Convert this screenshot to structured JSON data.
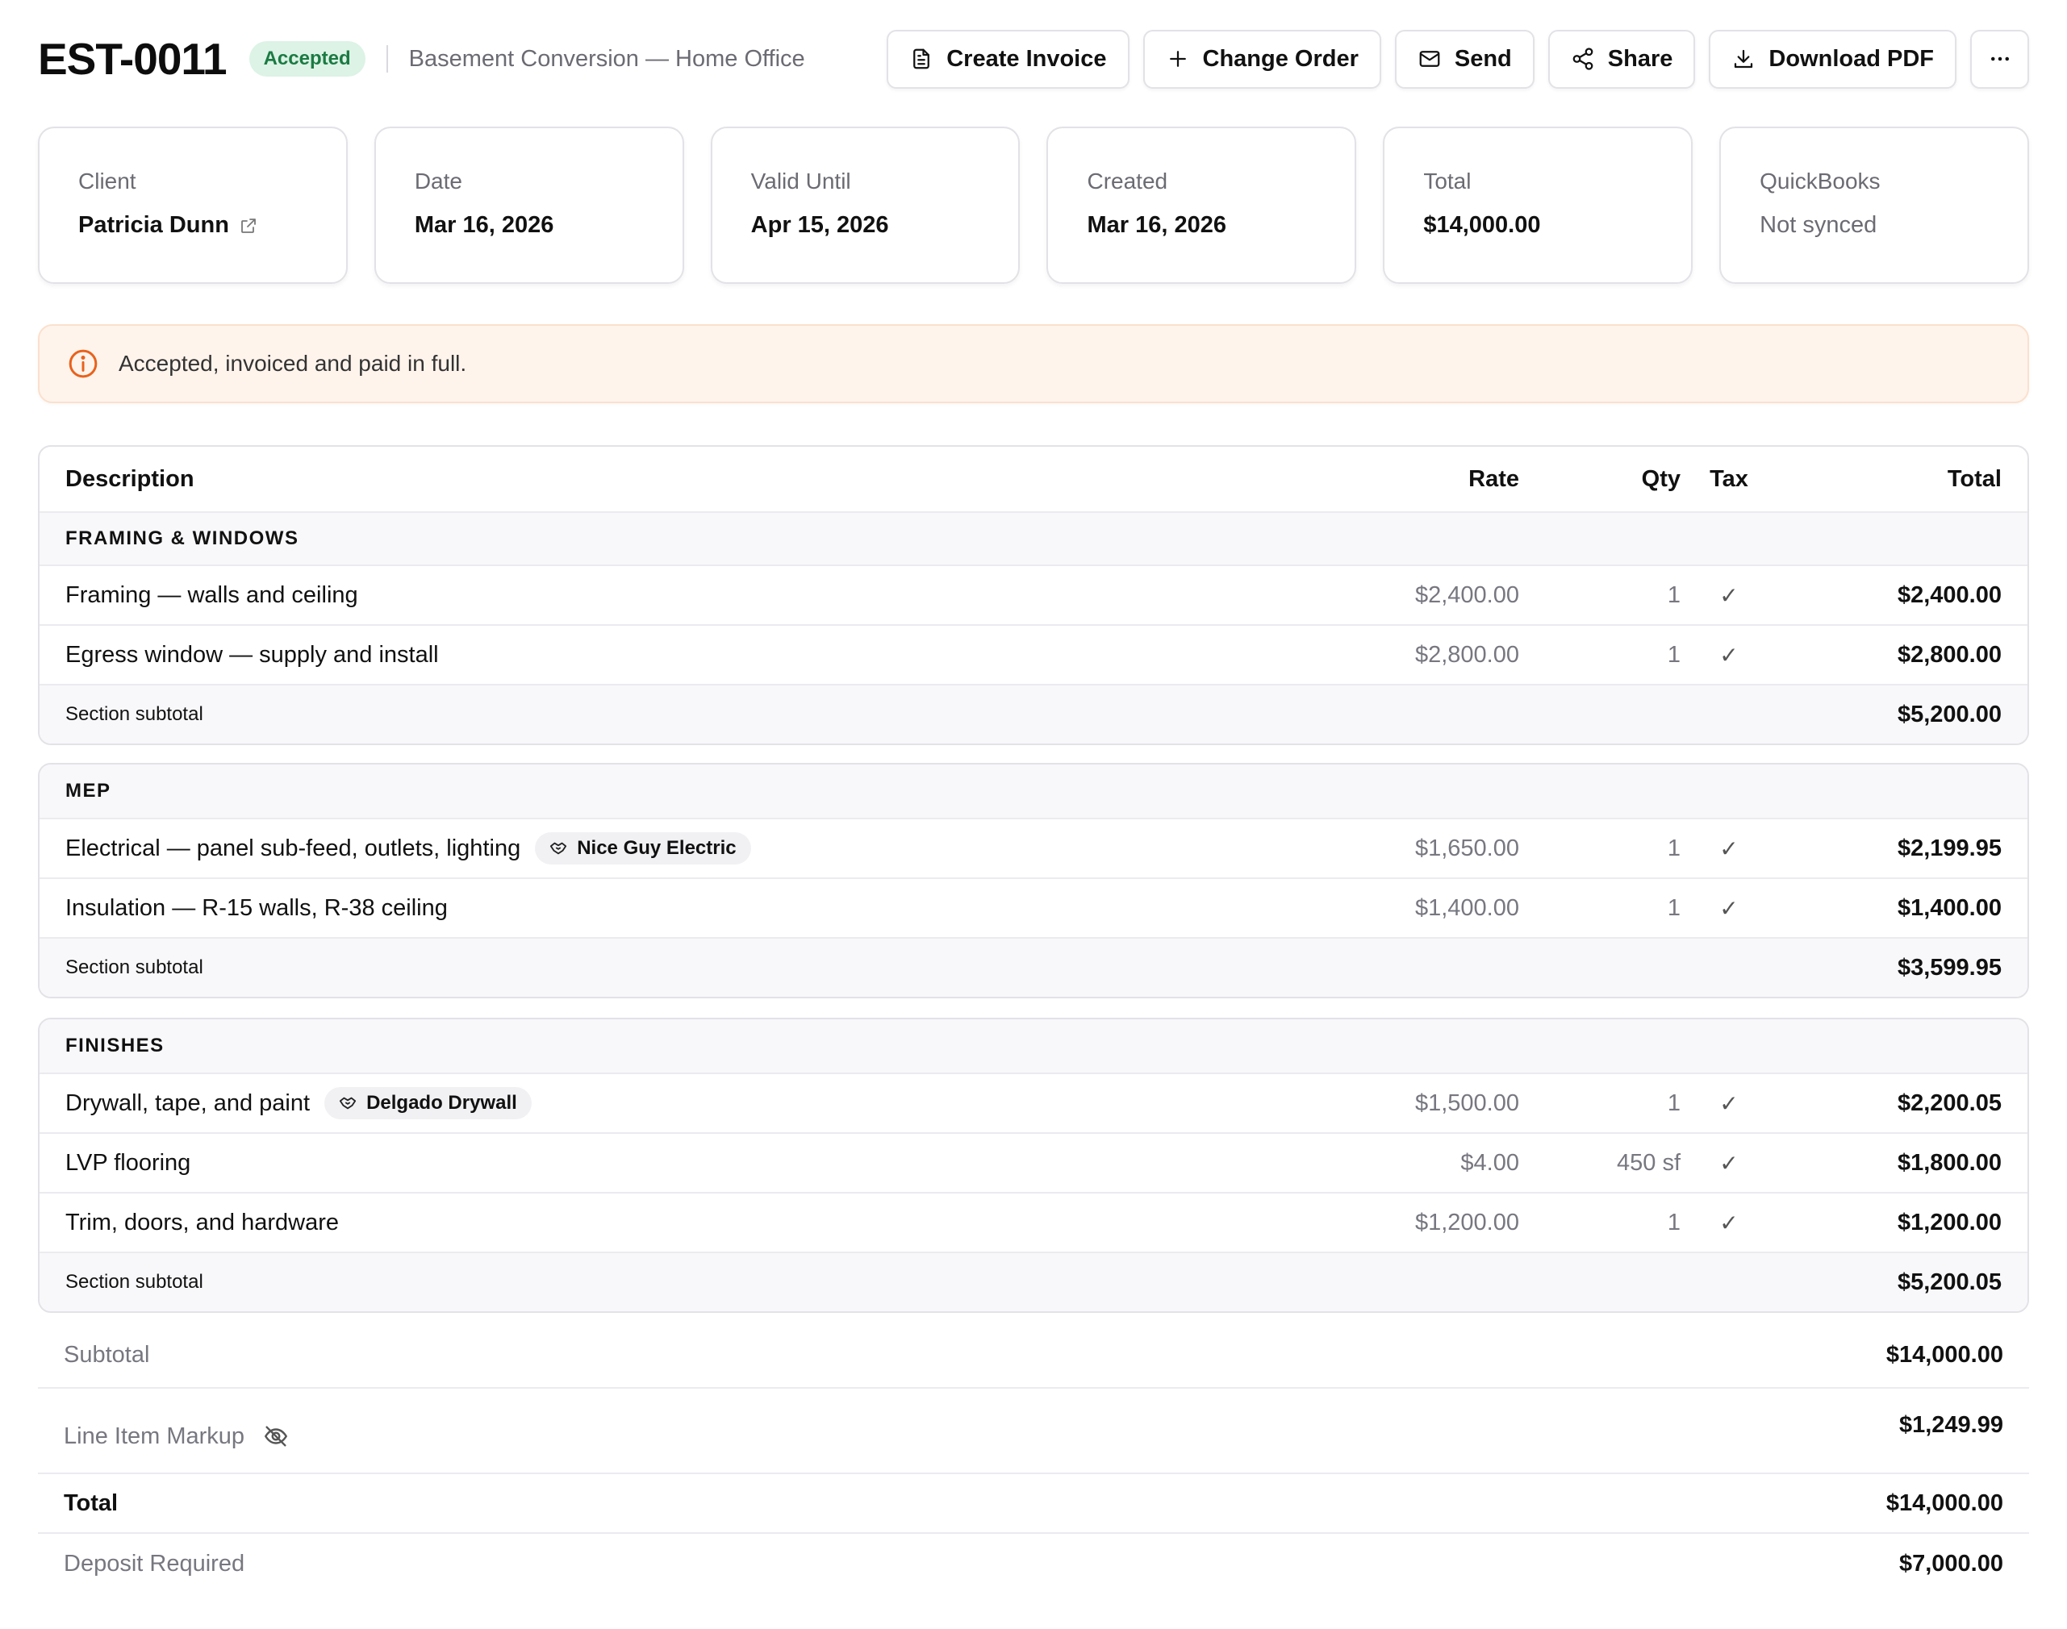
{
  "header": {
    "estimate_id": "EST-0011",
    "status": "Accepted",
    "project": "Basement Conversion — Home Office",
    "actions": {
      "create_invoice": "Create Invoice",
      "change_order": "Change Order",
      "send": "Send",
      "share": "Share",
      "download_pdf": "Download PDF",
      "more": "···"
    }
  },
  "cards": {
    "client": {
      "label": "Client",
      "value": "Patricia Dunn"
    },
    "date": {
      "label": "Date",
      "value": "Mar 16, 2026"
    },
    "valid_until": {
      "label": "Valid Until",
      "value": "Apr 15, 2026"
    },
    "created": {
      "label": "Created",
      "value": "Mar 16, 2026"
    },
    "total": {
      "label": "Total",
      "value": "$14,000.00"
    },
    "quickbooks": {
      "label": "QuickBooks",
      "value": "Not synced"
    }
  },
  "alert": {
    "text": "Accepted, invoiced and paid in full."
  },
  "table": {
    "columns": {
      "description": "Description",
      "rate": "Rate",
      "qty": "Qty",
      "tax": "Tax",
      "total": "Total"
    },
    "subtotal_label": "Section subtotal",
    "sections": [
      {
        "title": "FRAMING & WINDOWS",
        "items": [
          {
            "description": "Framing — walls and ceiling",
            "rate": "$2,400.00",
            "qty": "1",
            "tax": "✓",
            "total": "$2,400.00"
          },
          {
            "description": "Egress window — supply and install",
            "rate": "$2,800.00",
            "qty": "1",
            "tax": "✓",
            "total": "$2,800.00"
          }
        ],
        "subtotal": "$5,200.00"
      },
      {
        "title": "MEP",
        "items": [
          {
            "description": "Electrical — panel sub-feed, outlets, lighting",
            "sub": "Nice Guy Electric",
            "rate": "$1,650.00",
            "qty": "1",
            "tax": "✓",
            "total": "$2,199.95"
          },
          {
            "description": "Insulation — R-15 walls, R-38 ceiling",
            "rate": "$1,400.00",
            "qty": "1",
            "tax": "✓",
            "total": "$1,400.00"
          }
        ],
        "subtotal": "$3,599.95"
      },
      {
        "title": "FINISHES",
        "items": [
          {
            "description": "Drywall, tape, and paint",
            "sub": "Delgado Drywall",
            "rate": "$1,500.00",
            "qty": "1",
            "tax": "✓",
            "total": "$2,200.05"
          },
          {
            "description": "LVP flooring",
            "rate": "$4.00",
            "qty": "450 sf",
            "tax": "✓",
            "total": "$1,800.00"
          },
          {
            "description": "Trim, doors, and hardware",
            "rate": "$1,200.00",
            "qty": "1",
            "tax": "✓",
            "total": "$1,200.00"
          }
        ],
        "subtotal": "$5,200.05"
      }
    ]
  },
  "summary": {
    "subtotal": {
      "label": "Subtotal",
      "value": "$14,000.00"
    },
    "markup": {
      "label": "Line Item Markup",
      "value": "$1,249.99"
    },
    "total": {
      "label": "Total",
      "value": "$14,000.00"
    },
    "deposit": {
      "label": "Deposit Required",
      "value": "$7,000.00"
    }
  }
}
